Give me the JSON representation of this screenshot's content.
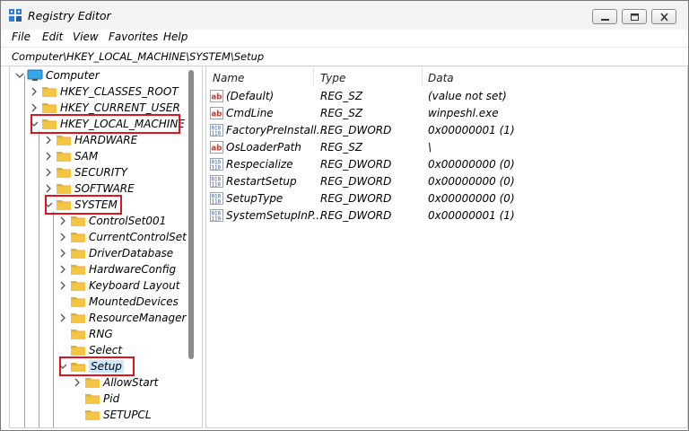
{
  "window": {
    "title": "Registry Editor",
    "app_icon": "registry-icon"
  },
  "menu": [
    "File",
    "Edit",
    "View",
    "Favorites",
    "Help"
  ],
  "address": "Computer\\HKEY_LOCAL_MACHINE\\SYSTEM\\Setup",
  "colors": {
    "highlight": "#e0141e",
    "folder": "#f4c542",
    "selection": "#cce8ff"
  },
  "tree": [
    {
      "label": "Computer",
      "icon": "computer-icon",
      "level": 0,
      "expander": "expanded"
    },
    {
      "label": "HKEY_CLASSES_ROOT",
      "icon": "folder-icon",
      "level": 1,
      "expander": "collapsed"
    },
    {
      "label": "HKEY_CURRENT_USER",
      "icon": "folder-icon",
      "level": 1,
      "expander": "collapsed"
    },
    {
      "label": "HKEY_LOCAL_MACHINE",
      "icon": "folder-icon",
      "level": 1,
      "expander": "expanded",
      "highlighted": true
    },
    {
      "label": "HARDWARE",
      "icon": "folder-icon",
      "level": 2,
      "expander": "collapsed"
    },
    {
      "label": "SAM",
      "icon": "folder-icon",
      "level": 2,
      "expander": "collapsed"
    },
    {
      "label": "SECURITY",
      "icon": "folder-icon",
      "level": 2,
      "expander": "collapsed"
    },
    {
      "label": "SOFTWARE",
      "icon": "folder-icon",
      "level": 2,
      "expander": "collapsed"
    },
    {
      "label": "SYSTEM",
      "icon": "folder-icon",
      "level": 2,
      "expander": "expanded",
      "highlighted": true
    },
    {
      "label": "ControlSet001",
      "icon": "folder-icon",
      "level": 3,
      "expander": "collapsed"
    },
    {
      "label": "CurrentControlSet",
      "icon": "folder-icon",
      "level": 3,
      "expander": "collapsed"
    },
    {
      "label": "DriverDatabase",
      "icon": "folder-icon",
      "level": 3,
      "expander": "collapsed"
    },
    {
      "label": "HardwareConfig",
      "icon": "folder-icon",
      "level": 3,
      "expander": "collapsed"
    },
    {
      "label": "Keyboard Layout",
      "icon": "folder-icon",
      "level": 3,
      "expander": "collapsed"
    },
    {
      "label": "MountedDevices",
      "icon": "folder-icon",
      "level": 3,
      "expander": "none"
    },
    {
      "label": "ResourceManager",
      "icon": "folder-icon",
      "level": 3,
      "expander": "collapsed"
    },
    {
      "label": "RNG",
      "icon": "folder-icon",
      "level": 3,
      "expander": "none"
    },
    {
      "label": "Select",
      "icon": "folder-icon",
      "level": 3,
      "expander": "none"
    },
    {
      "label": "Setup",
      "icon": "folder-open-icon",
      "level": 3,
      "expander": "expanded",
      "highlighted": true,
      "selected": true
    },
    {
      "label": "AllowStart",
      "icon": "folder-icon",
      "level": 4,
      "expander": "collapsed"
    },
    {
      "label": "Pid",
      "icon": "folder-icon",
      "level": 4,
      "expander": "none"
    },
    {
      "label": "SETUPCL",
      "icon": "folder-icon",
      "level": 4,
      "expander": "none"
    }
  ],
  "columns": {
    "name": "Name",
    "type": "Type",
    "data": "Data"
  },
  "values": [
    {
      "name": "(Default)",
      "type": "REG_SZ",
      "data": "(value not set)",
      "icon": "string-value-icon"
    },
    {
      "name": "CmdLine",
      "type": "REG_SZ",
      "data": "winpeshl.exe",
      "icon": "string-value-icon"
    },
    {
      "name": "FactoryPreInstall...",
      "type": "REG_DWORD",
      "data": "0x00000001 (1)",
      "icon": "binary-value-icon"
    },
    {
      "name": "OsLoaderPath",
      "type": "REG_SZ",
      "data": "\\",
      "icon": "string-value-icon"
    },
    {
      "name": "Respecialize",
      "type": "REG_DWORD",
      "data": "0x00000000 (0)",
      "icon": "binary-value-icon"
    },
    {
      "name": "RestartSetup",
      "type": "REG_DWORD",
      "data": "0x00000000 (0)",
      "icon": "binary-value-icon"
    },
    {
      "name": "SetupType",
      "type": "REG_DWORD",
      "data": "0x00000000 (0)",
      "icon": "binary-value-icon"
    },
    {
      "name": "SystemSetupInP...",
      "type": "REG_DWORD",
      "data": "0x00000001 (1)",
      "icon": "binary-value-icon"
    }
  ]
}
